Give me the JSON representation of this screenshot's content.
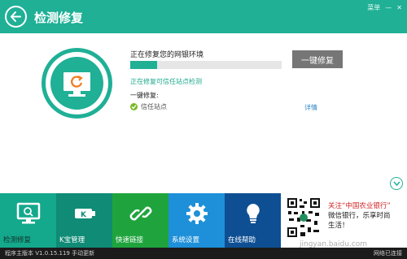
{
  "titlebar": {
    "title": "检测修复",
    "controls": [
      "菜单",
      "—",
      "✕"
    ]
  },
  "main": {
    "repair_status": "正在修复您的网银环境",
    "progress": 0.18,
    "one_click_label": "一键修复",
    "substatus": "正在修复可信任站点检测",
    "section_label": "一键修复:",
    "items": [
      {
        "label": "信任站点",
        "status": "ok"
      }
    ],
    "detail_link": "详情"
  },
  "tabs": [
    {
      "label": "检测修复",
      "icon": "monitor-icon"
    },
    {
      "label": "K宝管理",
      "icon": "k-key-icon"
    },
    {
      "label": "快速链接",
      "icon": "link-icon"
    },
    {
      "label": "系统设置",
      "icon": "gear-icon"
    },
    {
      "label": "在线帮助",
      "icon": "lightbulb-icon"
    }
  ],
  "promo": {
    "line1_prefix": "关注",
    "line1_highlight": "“中国农业银行”",
    "line2": "微信银行，乐享时尚",
    "line3": "生活！"
  },
  "watermark": "jingyan.baidu.com",
  "statusbar": {
    "version": "程序主版本 V1.0.15.119  手动更新",
    "network": "网络已连接"
  },
  "colors": {
    "accent": "#1fb096",
    "progress": "#22b095",
    "quick": "#1fa43d",
    "settings": "#1e90d9",
    "help": "#0e4f93"
  }
}
